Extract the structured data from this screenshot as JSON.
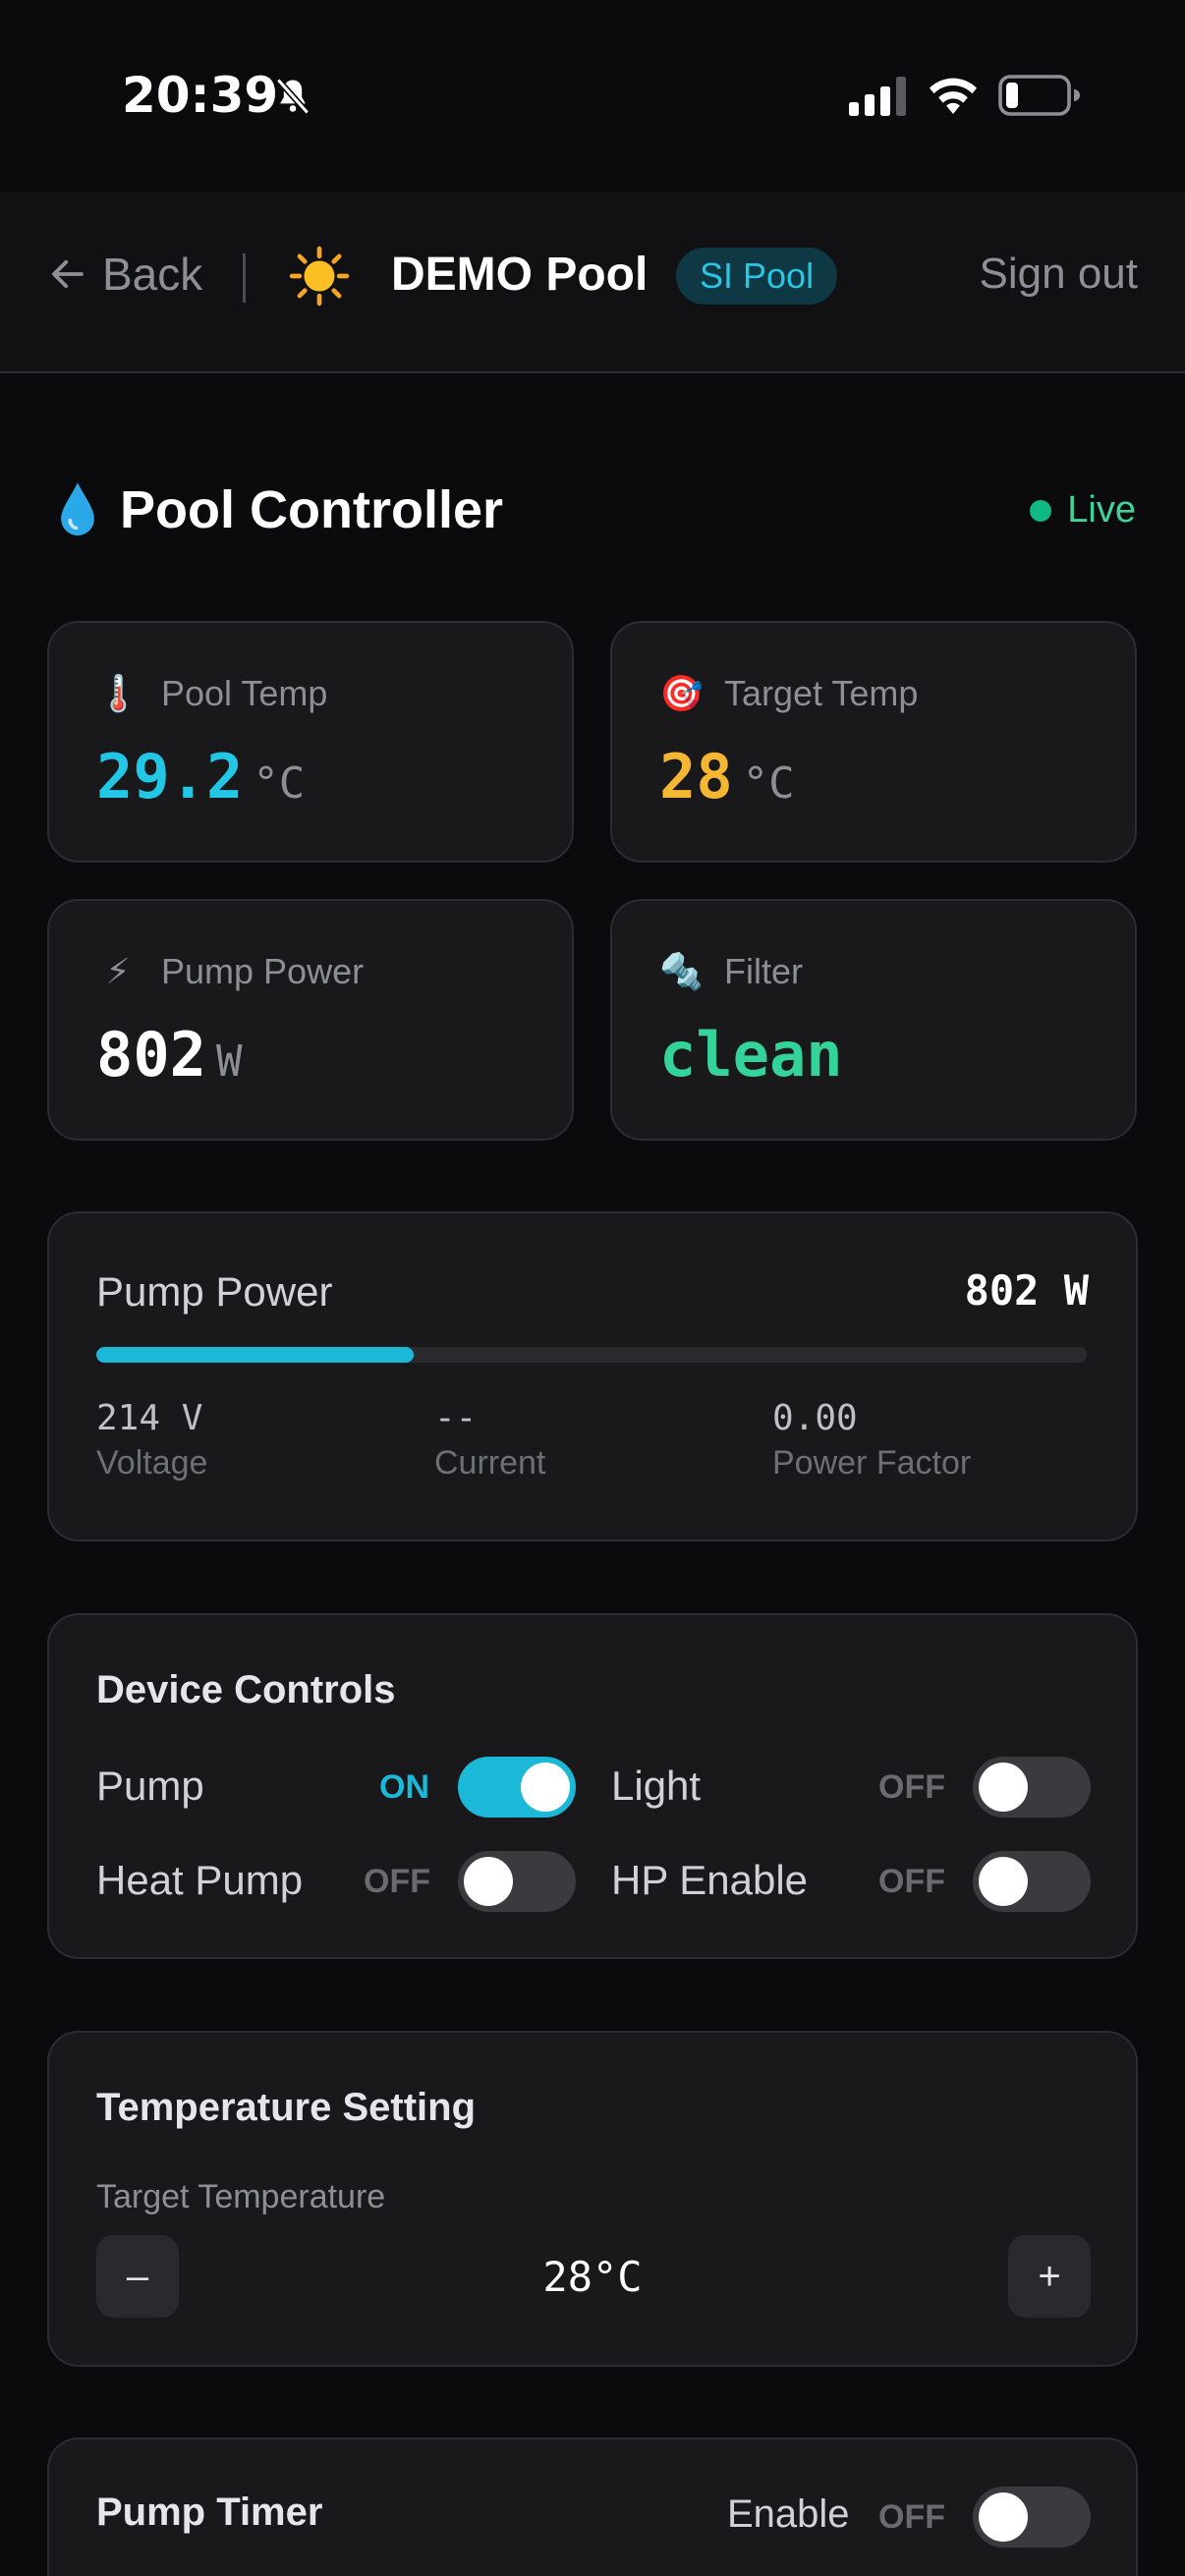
{
  "status_bar": {
    "time": "20:39",
    "bell_icon": "bell-slash-icon",
    "signal_icon": "cellular-signal-icon",
    "wifi_icon": "wifi-icon",
    "battery_icon": "battery-low-icon"
  },
  "header": {
    "back_label": "Back",
    "back_icon": "arrow-left-icon",
    "pool_icon": "sun-icon",
    "pool_name": "DEMO Pool",
    "badge": "SI Pool",
    "sign_out": "Sign out"
  },
  "section": {
    "title": "Pool Controller",
    "icon": "water-drop-icon",
    "status": "Live",
    "status_color": "#10b981"
  },
  "stats": [
    {
      "icon": "🌡️",
      "icon_name": "thermometer-icon",
      "label": "Pool Temp",
      "value": "29.2",
      "unit": "°C",
      "color": "#22c7e6"
    },
    {
      "icon": "🎯",
      "icon_name": "target-icon",
      "label": "Target Temp",
      "value": "28",
      "unit": "°C",
      "color": "#f5b731"
    },
    {
      "icon": "⚡",
      "icon_name": "lightning-icon",
      "label": "Pump Power",
      "value": "802",
      "unit": "W",
      "color": "#ffffff"
    },
    {
      "icon": "🔩",
      "icon_name": "filter-icon",
      "label": "Filter",
      "value": "clean",
      "unit": "",
      "color": "#34d399"
    }
  ],
  "pump_power": {
    "title": "Pump Power",
    "value": "802 W",
    "bar_fraction": 0.32,
    "metrics": [
      {
        "value": "214 V",
        "label": "Voltage"
      },
      {
        "value": "--",
        "label": "Current"
      },
      {
        "value": "0.00",
        "label": "Power Factor"
      }
    ]
  },
  "device_controls": {
    "title": "Device Controls",
    "items": [
      {
        "name": "Pump",
        "state": "ON",
        "on": true
      },
      {
        "name": "Light",
        "state": "OFF",
        "on": false
      },
      {
        "name": "Heat Pump",
        "state": "OFF",
        "on": false
      },
      {
        "name": "HP Enable",
        "state": "OFF",
        "on": false
      }
    ]
  },
  "temperature_setting": {
    "title": "Temperature Setting",
    "label": "Target Temperature",
    "minus": "–",
    "plus": "+",
    "value": "28°C"
  },
  "pump_timer": {
    "title": "Pump Timer",
    "enable_label": "Enable",
    "state": "OFF",
    "on": false
  },
  "colors": {
    "accent": "#1bb8d8",
    "background": "#0b0b0d",
    "card": "#19191c"
  }
}
